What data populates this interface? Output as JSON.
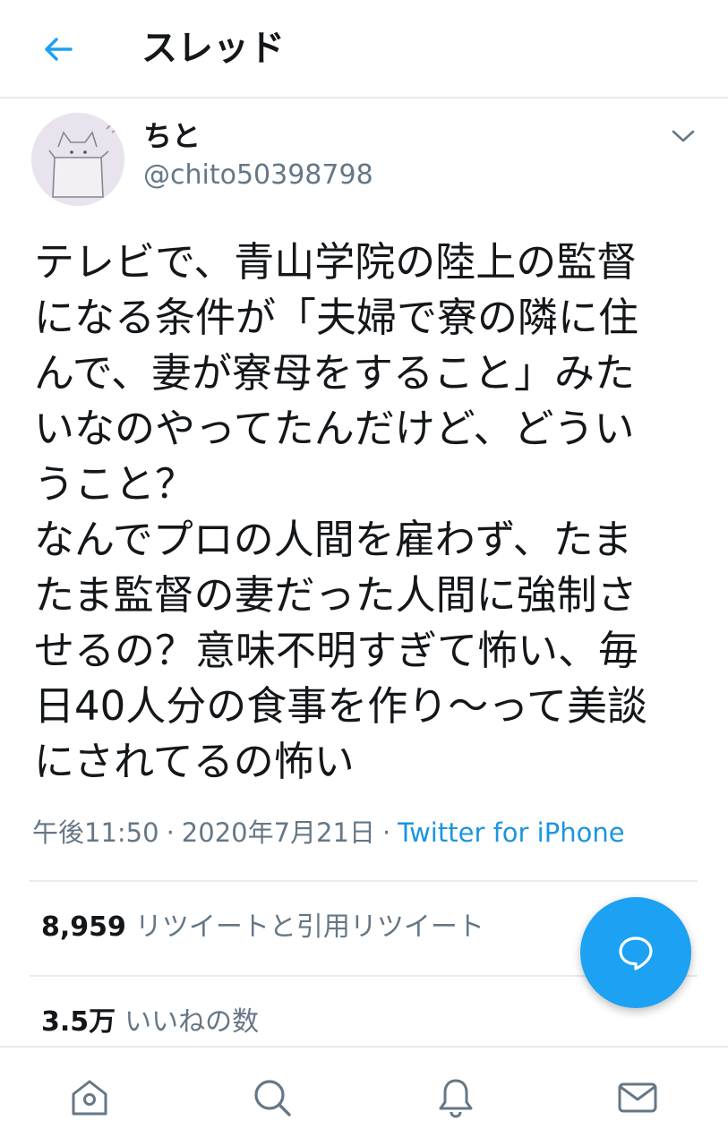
{
  "header": {
    "title": "スレッド",
    "back_icon": "arrow-left-icon"
  },
  "author": {
    "name": "ちと",
    "handle": "@chito50398798",
    "avatar_icon": "cat-in-box-avatar",
    "menu_icon": "chevron-down-icon"
  },
  "tweet": {
    "text": "テレビで、青山学院の陸上の監督\nになる条件が「夫婦で寮の隣に住\nんで、妻が寮母をすること」みた\nいなのやってたんだけど、どうい\nうこと？\nなんでプロの人間を雇わず、たま\nたま監督の妻だった人間に強制さ\nせるの？意味不明すぎて怖い、毎\n日40人分の食事を作り〜って美談\nにされてるの怖い",
    "time": "午後11:50",
    "date": "2020年7月21日",
    "separator": "·",
    "source": "Twitter for iPhone"
  },
  "stats": {
    "retweets_count": "8,959",
    "retweets_label": "リツイートと引用リツイート",
    "likes_count": "3.5万",
    "likes_label": "いいねの数"
  },
  "fab": {
    "icon": "reply-bubble-icon"
  },
  "bottom_nav": {
    "items": [
      {
        "icon": "home-icon"
      },
      {
        "icon": "search-icon"
      },
      {
        "icon": "bell-icon"
      },
      {
        "icon": "mail-icon"
      }
    ]
  },
  "colors": {
    "accent": "#1da1f2",
    "link": "#1b95e0",
    "secondary_text": "#657786",
    "primary_text": "#14171a",
    "divider": "#e6ecf0"
  }
}
